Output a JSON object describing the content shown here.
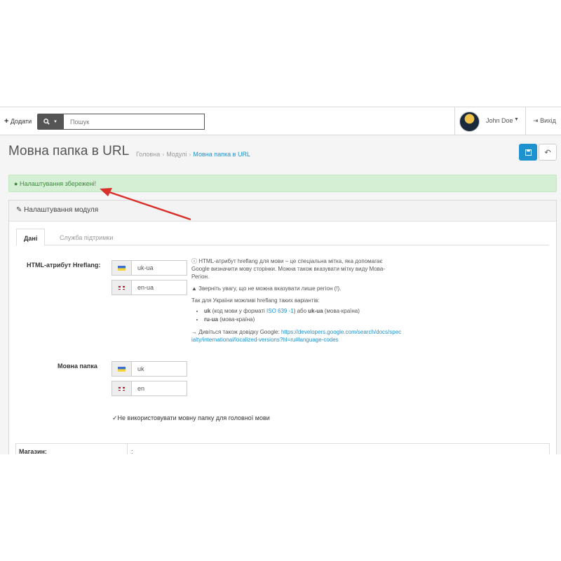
{
  "header": {
    "add_label": "Додати",
    "search_placeholder": "Пошук",
    "user_name": "John Doe",
    "logout_label": "Вихід"
  },
  "page": {
    "title": "Мовна папка в URL",
    "breadcrumb": [
      "Головна",
      "Модулі",
      "Мовна папка в URL"
    ]
  },
  "alert": {
    "text": "Налаштування збережені!"
  },
  "panel": {
    "title": "Налаштування модуля",
    "tabs": [
      "Дані",
      "Служба підтримки"
    ]
  },
  "form": {
    "hreflang_label": "HTML-атрибут Hreflang:",
    "hreflang_values": [
      "uk-ua",
      "en-ua"
    ],
    "folder_label": "Мовна папка",
    "folder_values": [
      "uk",
      "en"
    ],
    "checkbox_label": "Не використовувати мовну папку для головної мови"
  },
  "help": {
    "p1": "HTML-атрибут hreflang для мови – це спеціальна мітка, яка допомагає Google визначити мову сторінки. Можна також вказувати мітку виду Мова-Регіон.",
    "p2": "Зверніть увагу, що не можна вказувати лише регіон (!).",
    "p3": "Так для України можливі hreflang таких варіантів:",
    "li1_bold": "uk",
    "li1_text": " (код мови у форматі ",
    "li1_link": "ISO 639 -1",
    "li1_text2": ") або ",
    "li1_bold2": "uk-ua",
    "li1_text3": " (мова-країна)",
    "li2_bold": "ru-ua",
    "li2_text": " (мова-країна)",
    "p4_text": "→ Дивіться також довідку Google: ",
    "p4_link": "https://developers.google.com/search/docs/specialty/international/localized-versions?hl=ru#language-codes"
  },
  "store": {
    "label": "Магазин:",
    "value": ":"
  },
  "colors": {
    "accent": "#1e91cf",
    "success_bg": "#d5efd5",
    "arrow": "#d9302a"
  }
}
